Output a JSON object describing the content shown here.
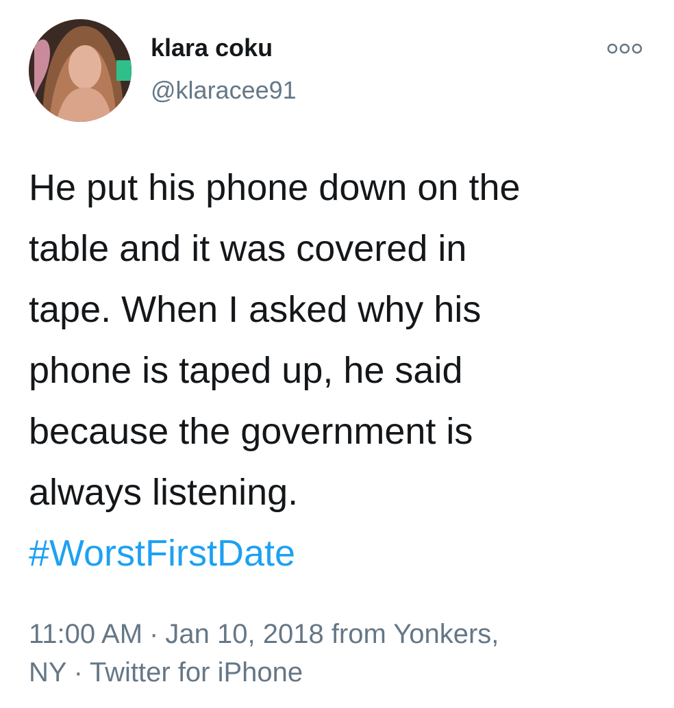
{
  "author": {
    "name": "klara coku",
    "handle": "@klaracee91",
    "avatar_icon": "avatar-photo"
  },
  "more_icon": "ellipsis-circles-icon",
  "tweet": {
    "text_lines": [
      "He put his phone down on the",
      "table and it was covered in",
      "tape. When I asked why his",
      "phone is taped up, he said",
      "because the government is",
      "always listening."
    ],
    "hashtag": "#WorstFirstDate"
  },
  "meta": {
    "time": "11:00 AM",
    "separator": "·",
    "date": "Jan 10, 2018",
    "location_prefix": "from",
    "location_line1": "Yonkers,",
    "location_line2": "NY",
    "source": "Twitter for iPhone"
  },
  "colors": {
    "text": "#14171a",
    "secondary": "#657786",
    "hashtag": "#1da1f2",
    "background": "#ffffff"
  }
}
